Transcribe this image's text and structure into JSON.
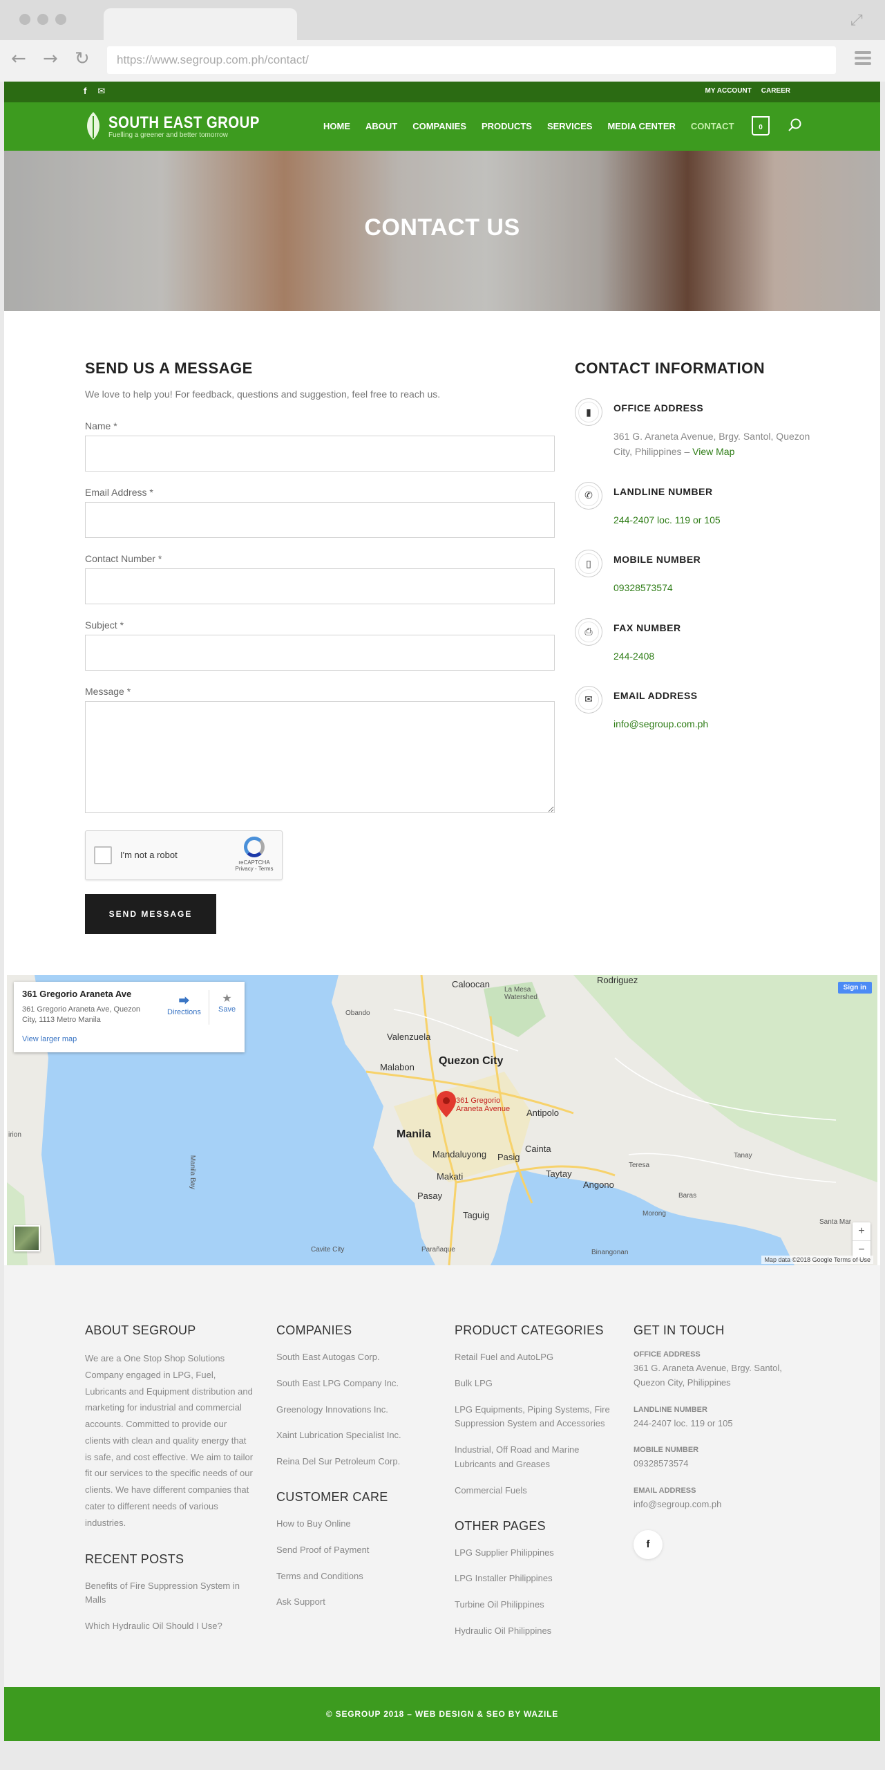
{
  "browser": {
    "url": "https://www.segroup.com.ph/contact/"
  },
  "topbar": {
    "links": [
      "MY ACCOUNT",
      "CAREER"
    ]
  },
  "header": {
    "logo_name": "SOUTH EAST GROUP",
    "logo_tagline": "Fuelling a greener and better tomorrow",
    "nav": [
      "HOME",
      "ABOUT",
      "COMPANIES",
      "PRODUCTS",
      "SERVICES",
      "MEDIA CENTER",
      "CONTACT"
    ],
    "cart_count": "0"
  },
  "hero": {
    "title": "CONTACT US"
  },
  "form": {
    "title": "SEND US A MESSAGE",
    "intro": "We love to help you! For feedback, questions and suggestion, feel free to reach us.",
    "fields": {
      "name": "Name *",
      "email": "Email Address *",
      "contact": "Contact Number *",
      "subject": "Subject *",
      "message": "Message *"
    },
    "recaptcha_label": "I'm not a robot",
    "recaptcha_brand": "reCAPTCHA",
    "recaptcha_links": "Privacy - Terms",
    "submit": "SEND MESSAGE"
  },
  "contact_info": {
    "title": "CONTACT INFORMATION",
    "office_title": "OFFICE ADDRESS",
    "office_address": "361 G. Araneta Avenue, Brgy. Santol, Quezon City, Philippines –",
    "view_map": "View Map",
    "landline_title": "LANDLINE NUMBER",
    "landline": "244-2407 loc. 119 or 105",
    "mobile_title": "MOBILE NUMBER",
    "mobile": "09328573574",
    "fax_title": "FAX NUMBER",
    "fax": "244-2408",
    "email_title": "EMAIL ADDRESS",
    "email": "info@segroup.com.ph"
  },
  "map": {
    "card_title": "361 Gregorio Araneta Ave",
    "card_address": "361 Gregorio Araneta Ave, Quezon City, 1113 Metro Manila",
    "directions": "Directions",
    "save": "Save",
    "larger": "View larger map",
    "signin": "Sign in",
    "pin_label": "361 Gregorio Araneta Avenue",
    "attribution": "Map data ©2018 Google   Terms of Use",
    "places": {
      "rodriguez": "Rodriguez",
      "caloocan": "Caloocan",
      "la_mesa": "La Mesa Watershed",
      "valenzuela": "Valenzuela",
      "quezon": "Quezon City",
      "malabon": "Malabon",
      "antipolo": "Antipolo",
      "manila": "Manila",
      "mandaluyong": "Mandaluyong",
      "pasig": "Pasig",
      "cainta": "Cainta",
      "taytay": "Taytay",
      "makati": "Makati",
      "pasay": "Pasay",
      "taguig": "Taguig",
      "angono": "Angono",
      "teresa": "Teresa",
      "tanay": "Tanay",
      "baras": "Baras",
      "morong": "Morong",
      "binangonan": "Binangonan",
      "paranaque": "Parañaque",
      "cavite": "Cavite City",
      "obando": "Obando",
      "manila_bay": "Manila Bay",
      "irion": "irion",
      "santa_mar": "Santa Mar"
    }
  },
  "footer": {
    "about_title": "ABOUT SEGROUP",
    "about_text": "We are a One Stop Shop Solutions Company engaged in LPG, Fuel, Lubricants and Equipment distribution and marketing for industrial and commercial accounts. Committed to provide our clients with clean and quality energy that is safe, and cost effective. We aim to tailor fit our services to the specific needs of our clients. We have different companies that cater to different needs of various industries.",
    "recent_title": "RECENT POSTS",
    "recent_posts": [
      "Benefits of Fire Suppression System in Malls",
      "Which Hydraulic Oil Should I Use?"
    ],
    "companies_title": "COMPANIES",
    "companies": [
      "South East Autogas Corp.",
      "South East LPG Company Inc.",
      "Greenology Innovations Inc.",
      "Xaint Lubrication Specialist Inc.",
      "Reina Del Sur Petroleum Corp."
    ],
    "care_title": "CUSTOMER CARE",
    "care": [
      "How to Buy Online",
      "Send Proof of Payment",
      "Terms and Conditions",
      "Ask Support"
    ],
    "products_title": "PRODUCT CATEGORIES",
    "products": [
      "Retail Fuel and AutoLPG",
      "Bulk LPG",
      "LPG Equipments, Piping Systems, Fire Suppression System and Accessories",
      "Industrial, Off Road and Marine Lubricants and Greases",
      "Commercial Fuels"
    ],
    "other_title": "OTHER PAGES",
    "other": [
      "LPG Supplier Philippines",
      "LPG Installer Philippines",
      "Turbine Oil Philippines",
      "Hydraulic Oil Philippines"
    ],
    "touch_title": "GET IN TOUCH",
    "touch": {
      "office_label": "OFFICE ADDRESS",
      "office": "361 G. Araneta Avenue, Brgy. Santol, Quezon City, Philippines",
      "landline_label": "LANDLINE NUMBER",
      "landline": "244-2407 loc. 119 or 105",
      "mobile_label": "MOBILE NUMBER",
      "mobile": "09328573574",
      "email_label": "EMAIL ADDRESS",
      "email": "info@segroup.com.ph"
    },
    "copyright": "© SEGROUP 2018 – WEB DESIGN & SEO BY WAZILE"
  },
  "colors": {
    "brand_green": "#3d9b1f",
    "dark_green": "#2b6b13",
    "link_green": "#2f7d17",
    "button_dark": "#1d1d1d"
  }
}
